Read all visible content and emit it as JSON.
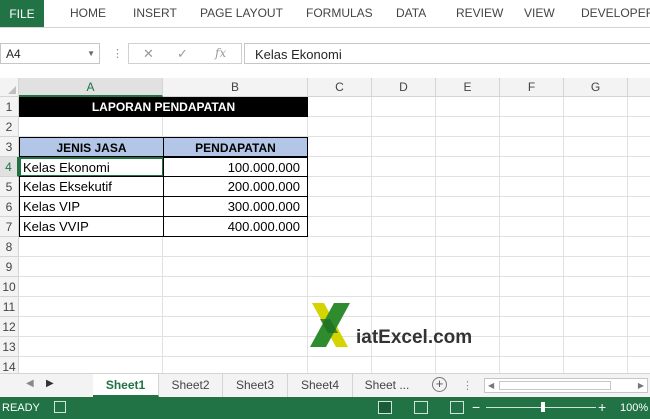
{
  "ribbon": {
    "file": "FILE",
    "tabs": [
      "HOME",
      "INSERT",
      "PAGE LAYOUT",
      "FORMULAS",
      "DATA",
      "REVIEW",
      "VIEW",
      "DEVELOPER"
    ]
  },
  "formula_bar": {
    "name_box": "A4",
    "cancel_icon": "✕",
    "enter_icon": "✓",
    "fx_label": "fx",
    "content": "Kelas Ekonomi"
  },
  "grid": {
    "columns": [
      "A",
      "B",
      "C",
      "D",
      "E",
      "F",
      "G"
    ],
    "rows": [
      "1",
      "2",
      "3",
      "4",
      "5",
      "6",
      "7",
      "8",
      "9",
      "10",
      "11",
      "12",
      "13",
      "14"
    ],
    "selected_column": "A",
    "selected_row": "4"
  },
  "sheet": {
    "title": "LAPORAN PENDAPATAN",
    "headers": {
      "jenis": "JENIS JASA",
      "pendapatan": "PENDAPATAN"
    },
    "rows": [
      {
        "jenis": "Kelas Ekonomi",
        "pendapatan": "100.000.000"
      },
      {
        "jenis": "Kelas Eksekutif",
        "pendapatan": "200.000.000"
      },
      {
        "jenis": "Kelas VIP",
        "pendapatan": "300.000.000"
      },
      {
        "jenis": "Kelas VVIP",
        "pendapatan": "400.000.000"
      }
    ]
  },
  "watermark": {
    "text": "iatExcel.com",
    "colors": {
      "green": "#2e8b2e",
      "yellow": "#d4d400"
    }
  },
  "tabs_bar": {
    "sheets": [
      "Sheet1",
      "Sheet2",
      "Sheet3",
      "Sheet4",
      "Sheet ..."
    ],
    "active": "Sheet1",
    "add_icon": "+"
  },
  "status_bar": {
    "ready": "READY",
    "zoom": "100%",
    "zoom_minus": "−",
    "zoom_plus": "+"
  },
  "colors": {
    "excel_green": "#217346",
    "header_fill": "#b4c6e7",
    "title_fill": "#000000"
  }
}
